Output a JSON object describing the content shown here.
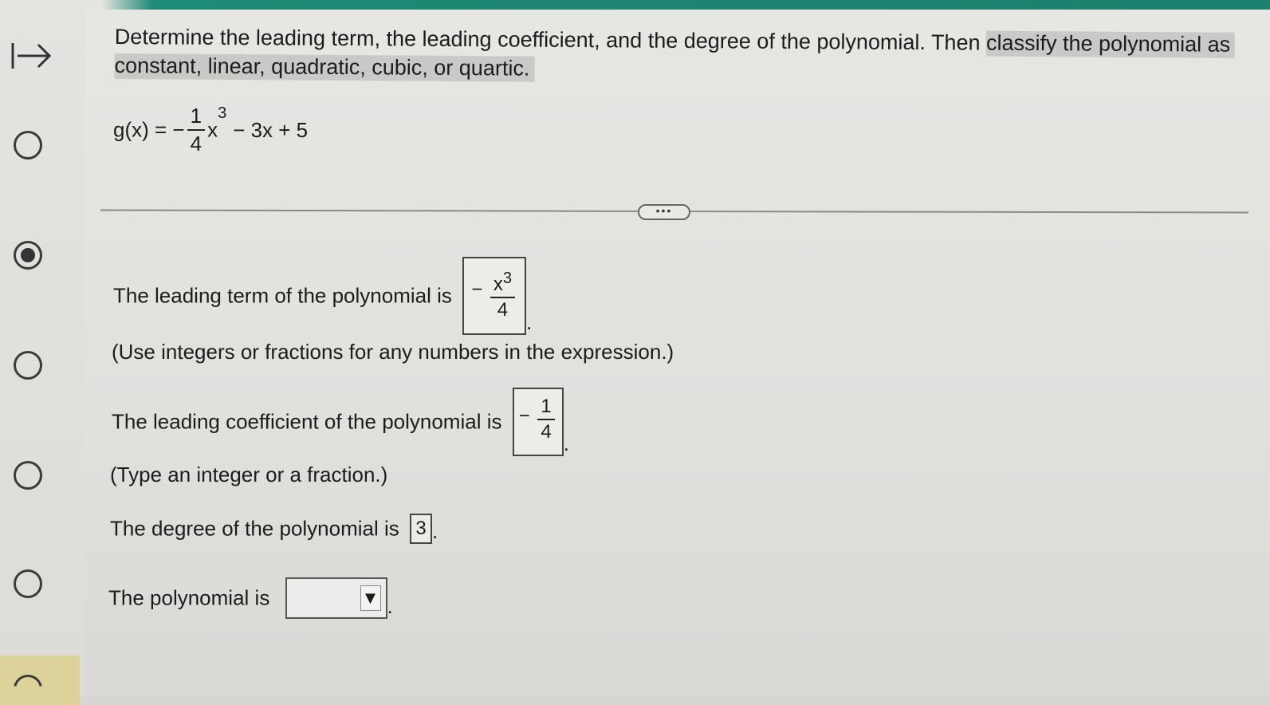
{
  "question": {
    "instructions_part1": "Determine the leading term, the leading coefficient, and the degree of the polynomial. Then ",
    "instructions_part2": "classify the polynomial as",
    "instructions_part3": "constant, linear, quadratic, cubic, or quartic.",
    "equation": {
      "lhs": "g(x) = −",
      "frac_num": "1",
      "frac_den": "4",
      "var": "x",
      "exp": "3",
      "rest": "− 3x + 5"
    }
  },
  "more_button": "•••",
  "leading_term": {
    "label": "The leading term of the polynomial is",
    "sign": "−",
    "num_var": "x",
    "num_exp": "3",
    "den": "4",
    "period": ".",
    "hint": "(Use integers or fractions for any numbers in the expression.)"
  },
  "leading_coefficient": {
    "label": "The leading coefficient of the polynomial is",
    "sign": "−",
    "num": "1",
    "den": "4",
    "period": ".",
    "hint": "(Type an integer or a fraction.)"
  },
  "degree": {
    "label": "The degree of the polynomial is",
    "value": "3",
    "period": "."
  },
  "classification": {
    "label": "The polynomial is",
    "selected": "",
    "arrow": "▼",
    "period": "."
  }
}
